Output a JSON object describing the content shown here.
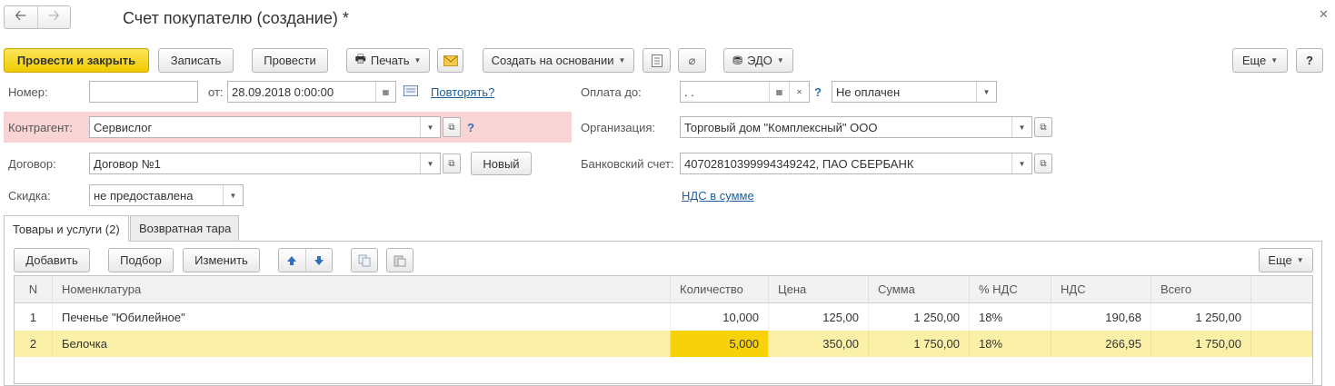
{
  "window": {
    "title": "Счет покупателю (создание) *"
  },
  "toolbar": {
    "post_close": "Провести и закрыть",
    "save": "Записать",
    "post": "Провести",
    "print": "Печать",
    "create_based": "Создать на основании",
    "edo": "ЭДО",
    "more": "Еще",
    "help": "?"
  },
  "form": {
    "number_label": "Номер:",
    "number_value": "",
    "from_label": "от:",
    "date_value": "28.09.2018  0:00:00",
    "repeat_link": "Повторять?",
    "pay_until_label": "Оплата до:",
    "pay_until_value": " .  .",
    "pay_status": "Не оплачен",
    "counterparty_label": "Контрагент:",
    "counterparty_value": "Сервислог",
    "org_label": "Организация:",
    "org_value": "Торговый дом \"Комплексный\" ООО",
    "contract_label": "Договор:",
    "contract_value": "Договор №1",
    "new_button": "Новый",
    "bank_label": "Банковский счет:",
    "bank_value": "40702810399994349242, ПАО СБЕРБАНК",
    "discount_label": "Скидка:",
    "discount_value": "не предоставлена",
    "vat_link": "НДС в сумме",
    "help_mark": "?"
  },
  "tabs": [
    {
      "label": "Товары и услуги (2)",
      "active": true
    },
    {
      "label": "Возвратная тара",
      "active": false
    }
  ],
  "table_toolbar": {
    "add": "Добавить",
    "pick": "Подбор",
    "change": "Изменить",
    "more": "Еще"
  },
  "table": {
    "columns": [
      "N",
      "Номенклатура",
      "Количество",
      "Цена",
      "Сумма",
      "% НДС",
      "НДС",
      "Всего"
    ],
    "rows": [
      {
        "n": "1",
        "name": "Печенье \"Юбилейное\"",
        "qty": "10,000",
        "price": "125,00",
        "sum": "1 250,00",
        "vat_rate": "18%",
        "vat": "190,68",
        "total": "1 250,00"
      },
      {
        "n": "2",
        "name": "Белочка",
        "qty": "5,000",
        "price": "350,00",
        "sum": "1 750,00",
        "vat_rate": "18%",
        "vat": "266,95",
        "total": "1 750,00"
      }
    ]
  },
  "colors": {
    "primary_button": "#f4d21c",
    "required_highlight": "#f8d4d4",
    "selected_row": "#fbf0a8",
    "active_cell": "#f7d20a",
    "link": "#1f5f9f"
  }
}
